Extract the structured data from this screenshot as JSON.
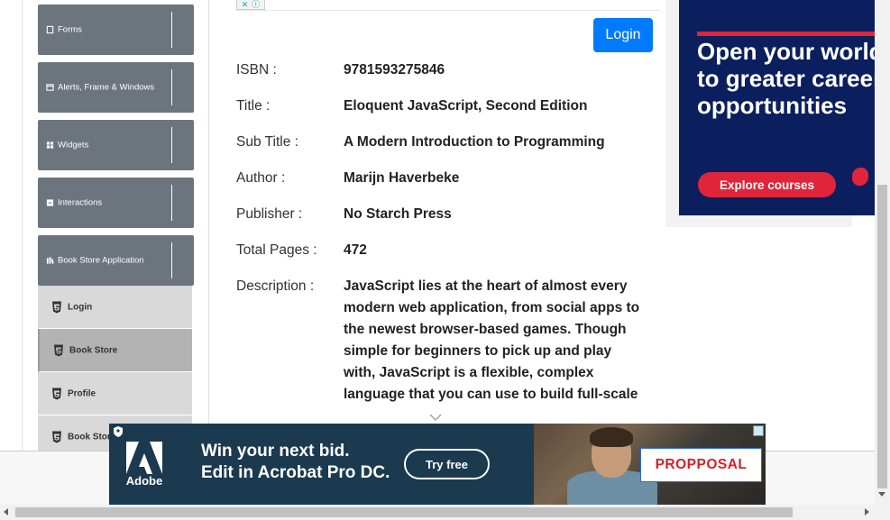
{
  "sidebar": {
    "groups": [
      {
        "label": "Forms",
        "icon": "form-icon",
        "expanded": false
      },
      {
        "label": "Alerts, Frame & Windows",
        "icon": "window-icon",
        "expanded": false
      },
      {
        "label": "Widgets",
        "icon": "widgets-icon",
        "expanded": false
      },
      {
        "label": "Interactions",
        "icon": "interactions-icon",
        "expanded": false
      },
      {
        "label": "Book Store Application",
        "icon": "bookstore-icon",
        "expanded": true
      }
    ],
    "sub_items": [
      {
        "label": "Login",
        "active": false
      },
      {
        "label": "Book Store",
        "active": true
      },
      {
        "label": "Profile",
        "active": false
      },
      {
        "label": "Book Store API",
        "active": false
      }
    ]
  },
  "main": {
    "login_label": "Login",
    "rows": [
      {
        "label": "ISBN :",
        "value": "9781593275846"
      },
      {
        "label": "Title :",
        "value": "Eloquent JavaScript, Second Edition"
      },
      {
        "label": "Sub Title :",
        "value": "A Modern Introduction to Programming"
      },
      {
        "label": "Author :",
        "value": "Marijn Haverbeke"
      },
      {
        "label": "Publisher :",
        "value": "No Starch Press"
      },
      {
        "label": "Total Pages :",
        "value": "472"
      },
      {
        "label": "Description :",
        "value": "JavaScript lies at the heart of almost every modern web application, from social apps to the newest browser-based games. Though simple for beginners to pick up and play with, JavaScript is a flexible, complex language that you can use to build full-scale"
      }
    ]
  },
  "right_ad": {
    "headline_lines": [
      "Open your world",
      "to greater career",
      "opportunities"
    ],
    "cta": "Explore courses"
  },
  "bottom_ad": {
    "brand": "Adobe",
    "line1": "Win your next bid.",
    "line2": "Edit in Acrobat Pro DC.",
    "cta": "Try free",
    "doc_word": "PROPPOSAL"
  },
  "colors": {
    "accent": "#007bff",
    "sidebar_group": "#6c757d",
    "sub_item": "#d9d9d9",
    "sub_item_active": "#b3b3b3",
    "ad_navy": "#0b1f5e",
    "ad_red": "#e0243a"
  }
}
